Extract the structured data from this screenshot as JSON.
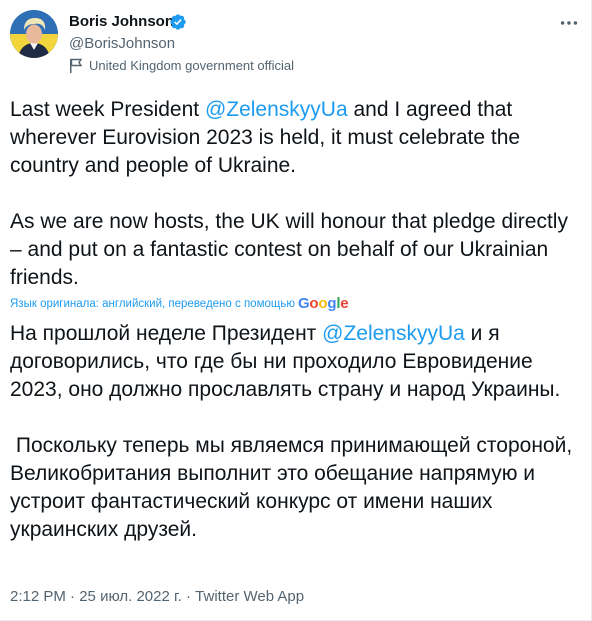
{
  "author": {
    "name": "Boris Johnson",
    "handle": "@BorisJohnson",
    "verified": true,
    "label_text": "United Kingdom government official"
  },
  "icons": {
    "verified": "verified-badge-icon",
    "more": "more-options-icon",
    "label": "flag-icon"
  },
  "tweet": {
    "p1_before": "Last week President ",
    "p1_mention": "@ZelenskyyUa",
    "p1_after": " and I agreed that wherever Eurovision 2023 is held, it must celebrate the country and people of Ukraine.",
    "p2": "As we are now hosts, the UK will honour that pledge directly – and put on a fantastic contest on behalf of our Ukrainian friends."
  },
  "translation": {
    "notice": "Язык оригинала: английский, переведено с помощью",
    "provider": "Google",
    "p1_before": "На прошлой неделе Президент ",
    "p1_mention": "@ZelenskyyUa",
    "p1_after": " и я договорились, что где бы ни проходило Евровидение 2023, оно должно прославлять страну и народ Украины.",
    "p2": " Поскольку теперь мы являемся принимающей стороной, Великобритания выполнит это обещание напрямую и устроит фантастический конкурс от имени наших украинских друзей."
  },
  "meta": {
    "time": "2:12 PM",
    "separator": " · ",
    "date": "25 июл. 2022 г.",
    "source": "Twitter Web App"
  },
  "colors": {
    "accent": "#1d9bf0",
    "text": "#0f1419",
    "secondary": "#536471"
  }
}
